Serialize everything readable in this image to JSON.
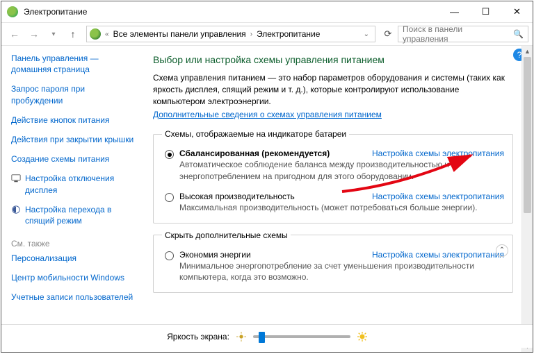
{
  "window": {
    "title": "Электропитание"
  },
  "nav": {
    "crumb1": "Все элементы панели управления",
    "crumb2": "Электропитание",
    "search_placeholder": "Поиск в панели управления"
  },
  "sidebar": {
    "links": [
      "Панель управления — домашняя страница",
      "Запрос пароля при пробуждении",
      "Действие кнопок питания",
      "Действия при закрытии крышки",
      "Создание схемы питания",
      "Настройка отключения дисплея",
      "Настройка перехода в спящий режим"
    ],
    "see_also_heading": "См. также",
    "see_also": [
      "Персонализация",
      "Центр мобильности Windows",
      "Учетные записи пользователей"
    ]
  },
  "main": {
    "heading": "Выбор или настройка схемы управления питанием",
    "desc": "Схема управления питанием — это набор параметров оборудования и системы (таких как яркость дисплея, спящий режим и т. д.), которые контролируют использование компьютером электроэнергии.",
    "learn_more": "Дополнительные сведения о схемах управления питанием",
    "group1_legend": "Схемы, отображаемые на индикаторе батареи",
    "group2_legend": "Скрыть дополнительные схемы",
    "change_link": "Настройка схемы электропитания",
    "plans": [
      {
        "name": "Сбалансированная (рекомендуется)",
        "desc": "Автоматическое соблюдение баланса между производительностью и энергопотреблением на пригодном для этого оборудовании.",
        "checked": true,
        "bold": true
      },
      {
        "name": "Высокая производительность",
        "desc": "Максимальная производительность (может потребоваться больше энергии).",
        "checked": false,
        "bold": false
      }
    ],
    "extra_plan": {
      "name": "Экономия энергии",
      "desc": "Минимальное энергопотребление за счет уменьшения производительности компьютера, когда это возможно."
    },
    "brightness_label": "Яркость экрана:"
  }
}
